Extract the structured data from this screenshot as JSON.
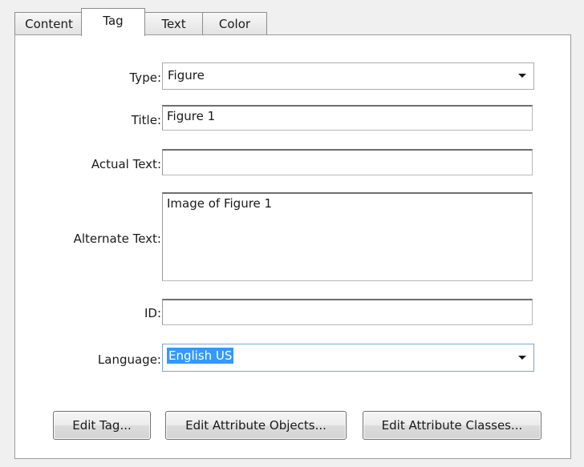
{
  "tabs": [
    {
      "label": "Content",
      "active": false
    },
    {
      "label": "Tag",
      "active": true
    },
    {
      "label": "Text",
      "active": false
    },
    {
      "label": "Color",
      "active": false
    }
  ],
  "form": {
    "type": {
      "label": "Type:",
      "value": "Figure"
    },
    "title": {
      "label": "Title:",
      "value": "Figure 1"
    },
    "actual_text": {
      "label": "Actual Text:",
      "value": ""
    },
    "alternate_text": {
      "label": "Alternate Text:",
      "value": "Image of Figure 1"
    },
    "id": {
      "label": "ID:",
      "value": ""
    },
    "language": {
      "label": "Language:",
      "value": "English US"
    }
  },
  "buttons": {
    "edit_tag": "Edit Tag...",
    "edit_attribute_objects": "Edit Attribute Objects...",
    "edit_attribute_classes": "Edit Attribute Classes..."
  },
  "colors": {
    "selection_highlight": "#3399ff",
    "panel_background": "#ffffff",
    "window_background": "#f0f0f0"
  }
}
